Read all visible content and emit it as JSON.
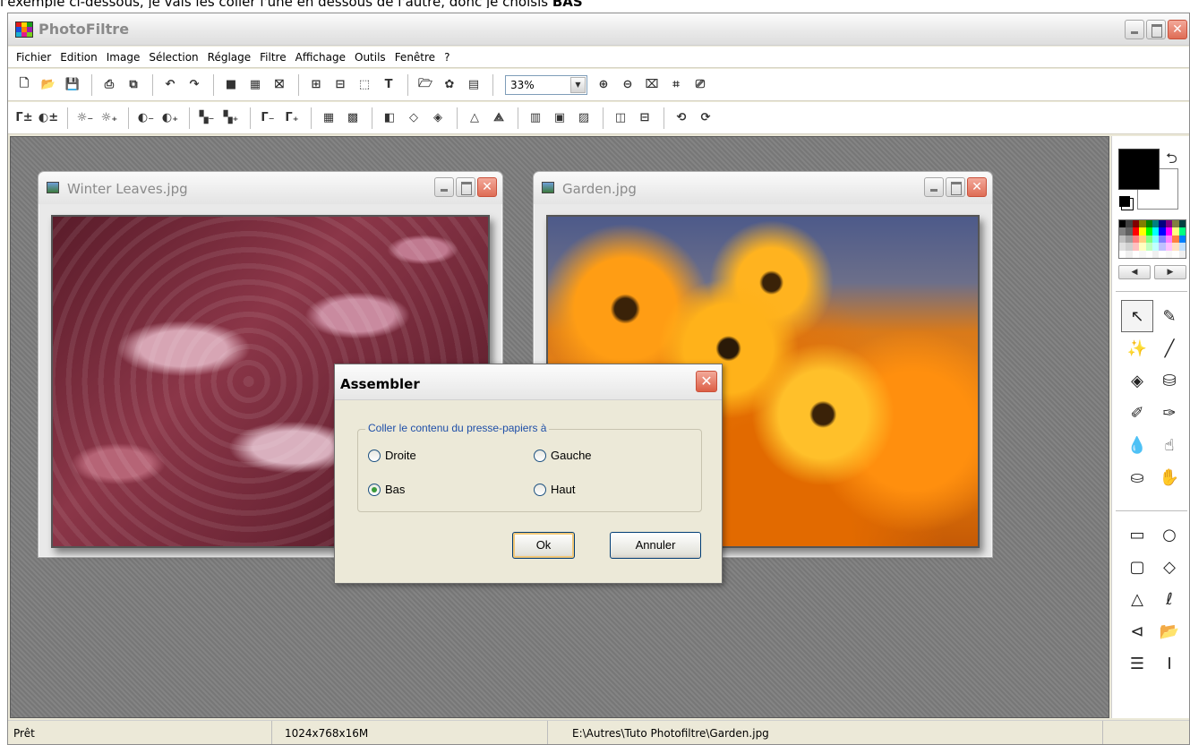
{
  "caption": {
    "text": "l'exemple ci-dessous, je vais les coller l'une en dessous de l'autre, donc je choisis ",
    "bold": "BAS"
  },
  "app": {
    "title": "PhotoFiltre"
  },
  "menu": [
    "Fichier",
    "Edition",
    "Image",
    "Sélection",
    "Réglage",
    "Filtre",
    "Affichage",
    "Outils",
    "Fenêtre",
    "?"
  ],
  "toolbar": {
    "zoom_value": "33%"
  },
  "windows": [
    {
      "title": "Winter Leaves.jpg"
    },
    {
      "title": "Garden.jpg"
    }
  ],
  "dialog": {
    "title": "Assembler",
    "group_label": "Coller le contenu du presse-papiers à",
    "options": [
      {
        "label": "Droite",
        "selected": false
      },
      {
        "label": "Gauche",
        "selected": false
      },
      {
        "label": "Bas",
        "selected": true
      },
      {
        "label": "Haut",
        "selected": false
      }
    ],
    "ok": "Ok",
    "cancel": "Annuler"
  },
  "colors": {
    "foreground": "#000000",
    "background": "#ffffff"
  },
  "status": {
    "state": "Prêt",
    "size": "1024x768x16M",
    "path": "E:\\Autres\\Tuto Photofiltre\\Garden.jpg"
  }
}
